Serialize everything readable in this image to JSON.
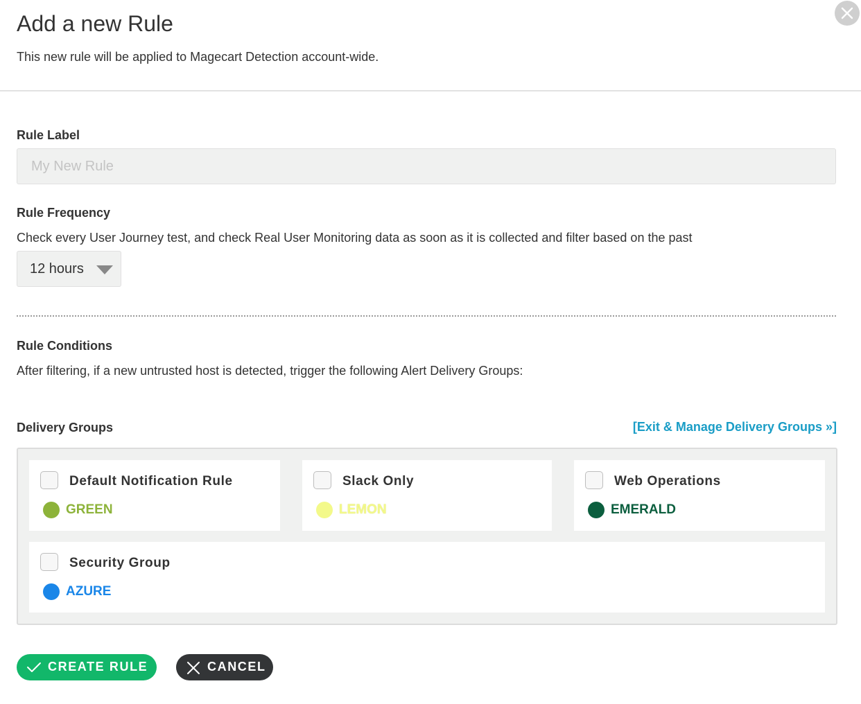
{
  "header": {
    "title": "Add a new Rule",
    "subtitle": "This new rule will be applied to Magecart Detection account-wide."
  },
  "rule_label": {
    "label": "Rule Label",
    "placeholder": "My New Rule",
    "value": ""
  },
  "rule_frequency": {
    "label": "Rule Frequency",
    "description": "Check every User Journey test, and check Real User Monitoring data as soon as it is collected and filter based on the past",
    "selected": "12 hours"
  },
  "rule_conditions": {
    "label": "Rule Conditions",
    "description": "After filtering, if a new untrusted host is detected, trigger the following Alert Delivery Groups:"
  },
  "delivery_groups": {
    "label": "Delivery Groups",
    "manage_link": "[Exit & Manage Delivery Groups »]",
    "groups": [
      {
        "name": "Default Notification Rule",
        "color_name": "GREEN",
        "color": "#8db33a",
        "checked": false
      },
      {
        "name": "Slack Only",
        "color_name": "LEMON",
        "color": "#f3f98a",
        "checked": false
      },
      {
        "name": "Web Operations",
        "color_name": "EMERALD",
        "color": "#0b5e3e",
        "checked": false
      },
      {
        "name": "Security Group",
        "color_name": "AZURE",
        "color": "#1a86e8",
        "checked": false
      }
    ]
  },
  "actions": {
    "create_label": "CREATE RULE",
    "cancel_label": "CANCEL"
  },
  "icons": {
    "close": "close-icon",
    "create": "checkmark-icon",
    "cancel": "x-icon",
    "dropdown": "caret-down-icon"
  },
  "colors": {
    "create_button": "#12b76a",
    "cancel_button": "#333537",
    "link": "#1a9dc6"
  }
}
